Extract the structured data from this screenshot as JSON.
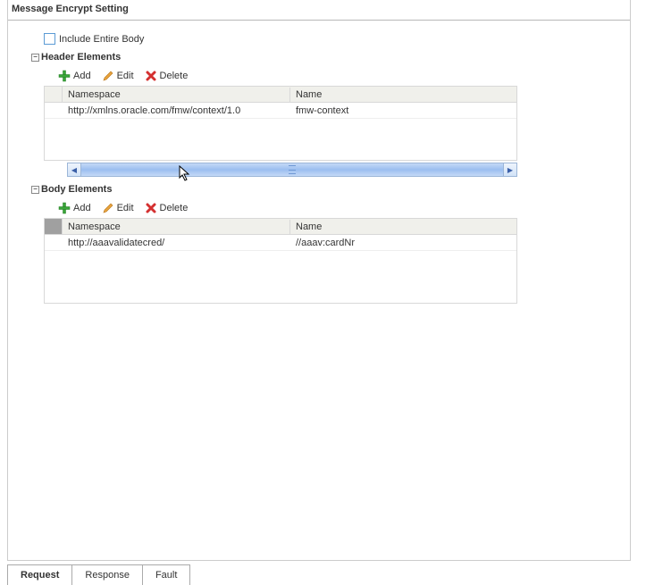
{
  "title": "Message Encrypt Setting",
  "include_body": {
    "label": "Include Entire Body",
    "checked": false
  },
  "sections": {
    "header": {
      "title": "Header Elements",
      "toolbar": {
        "add": "Add",
        "edit": "Edit",
        "delete": "Delete"
      },
      "columns": {
        "namespace": "Namespace",
        "name": "Name"
      },
      "rows": [
        {
          "namespace": "http://xmlns.oracle.com/fmw/context/1.0",
          "name": "fmw-context"
        }
      ]
    },
    "body": {
      "title": "Body Elements",
      "toolbar": {
        "add": "Add",
        "edit": "Edit",
        "delete": "Delete"
      },
      "columns": {
        "namespace": "Namespace",
        "name": "Name"
      },
      "rows": [
        {
          "namespace": "http://aaavalidatecred/",
          "name": "//aaav:cardNr"
        }
      ]
    }
  },
  "tabs": {
    "request": "Request",
    "response": "Response",
    "fault": "Fault",
    "active": "request"
  }
}
